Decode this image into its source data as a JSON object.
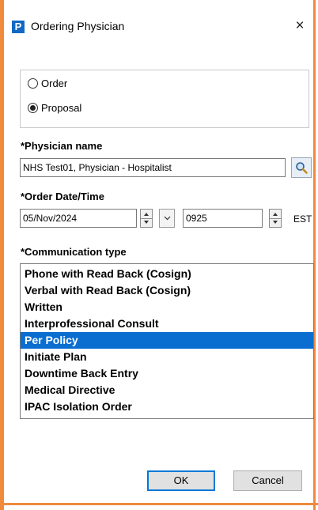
{
  "window": {
    "title": "Ordering Physician",
    "icon_glyph": "P",
    "icon_color": "#1268c4",
    "close_glyph": "×",
    "frame_color": "#f08a3c"
  },
  "order_type": {
    "options": [
      {
        "label": "Order",
        "checked": false
      },
      {
        "label": "Proposal",
        "checked": true
      }
    ]
  },
  "physician": {
    "label": "*Physician name",
    "value": "NHS Test01, Physician - Hospitalist",
    "search_icon": "search-icon"
  },
  "order_datetime": {
    "label": "*Order Date/Time",
    "date": "05/Nov/2024",
    "time": "0925",
    "timezone": "EST"
  },
  "communication": {
    "label": "*Communication type",
    "items": [
      "Phone with Read Back (Cosign)",
      "Verbal with Read Back (Cosign)",
      "Written",
      "Interprofessional Consult",
      "Per Policy",
      "Initiate Plan",
      "Downtime Back Entry",
      "Medical Directive",
      "IPAC Isolation Order"
    ],
    "selected_index": 4,
    "selected_color": "#0a6ed1"
  },
  "buttons": {
    "ok": "OK",
    "cancel": "Cancel"
  }
}
